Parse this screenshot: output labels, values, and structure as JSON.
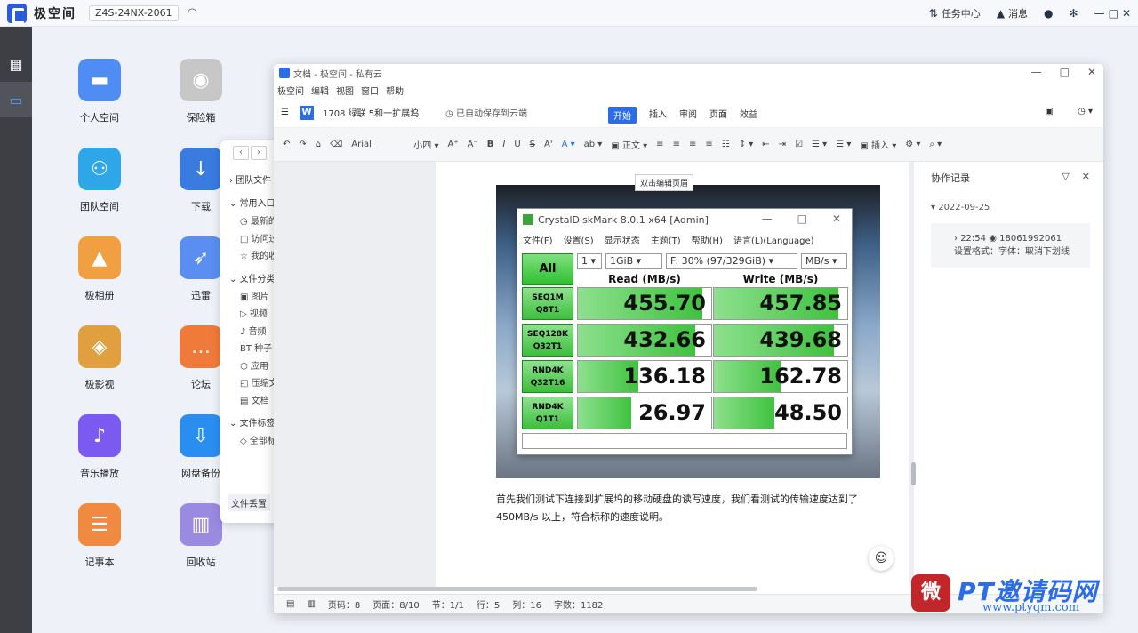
{
  "topbar": {
    "app_title": "极空间",
    "device": "Z4S-24NX-2061",
    "task_center": "任务中心",
    "messages": "消息"
  },
  "desktop": {
    "icons": [
      {
        "label": "个人空间",
        "color": "#4f8df5",
        "icon": "folder-icon"
      },
      {
        "label": "保险箱",
        "color": "#c7c7c7",
        "icon": "safe-icon"
      },
      {
        "label": "团队空间",
        "color": "#2fa6e8",
        "icon": "team-folder-icon"
      },
      {
        "label": "下载",
        "color": "#3a7be0",
        "icon": "download-globe-icon"
      },
      {
        "label": "极相册",
        "color": "#f0a040",
        "icon": "photo-album-icon"
      },
      {
        "label": "迅雷",
        "color": "#5a8ef0",
        "icon": "thunder-icon"
      },
      {
        "label": "极影视",
        "color": "#e0a040",
        "icon": "video-icon"
      },
      {
        "label": "论坛",
        "color": "#ef7a3a",
        "icon": "forum-icon"
      },
      {
        "label": "音乐播放",
        "color": "#7a5af0",
        "icon": "music-icon"
      },
      {
        "label": "网盘备份",
        "color": "#2a8ef0",
        "icon": "cloud-backup-icon"
      },
      {
        "label": "记事本",
        "color": "#f08a40",
        "icon": "notepad-icon"
      },
      {
        "label": "回收站",
        "color": "#9a8ae0",
        "icon": "trash-icon"
      }
    ]
  },
  "filemanager": {
    "team_files": "团队文件",
    "common": "常用入口",
    "recent": "最新的",
    "visit": "访问过",
    "mine": "我的收",
    "file_types": "文件分类",
    "images": "图片",
    "video": "视频",
    "audio": "音频",
    "seeds": "种子",
    "apps": "应用",
    "zip": "压缩文",
    "docs": "文档",
    "tags": "文件标签",
    "all_tags": "全部标",
    "footer": "文件丢置"
  },
  "doc": {
    "window_title": "文档 - 极空间 - 私有云",
    "menu": [
      "极空间",
      "编辑",
      "视图",
      "窗口",
      "帮助"
    ],
    "file_name": "1708 绿联 5和一扩展坞",
    "saved": "已自动保存到云端",
    "tabs": [
      "开始",
      "插入",
      "审阅",
      "页面",
      "效益"
    ],
    "font": "Arial",
    "size": "小四",
    "style": "正文",
    "insert": "插入",
    "tooltip": "双击编辑页眉",
    "paragraph": "首先我们测试下连接到扩展坞的移动硬盘的读写速度，我们看测试的传输速度达到了450MB/s 以上，符合标称的速度说明。",
    "status": {
      "page": "页码：8",
      "pages": "页面：8/10",
      "section": "节：1/1",
      "row": "行：5",
      "col": "列：16",
      "words": "字数：1182"
    },
    "collab": {
      "title": "协作记录",
      "date": "2022-09-25",
      "time": "22:54",
      "user": "18061992061",
      "action": "设置格式：字体：取消下划线"
    }
  },
  "cdm": {
    "title": "CrystalDiskMark 8.0.1 x64 [Admin]",
    "menu": [
      "文件(F)",
      "设置(S)",
      "显示状态",
      "主题(T)",
      "帮助(H)",
      "语言(L)(Language)"
    ],
    "all": "All",
    "count": "1",
    "size": "1GiB",
    "drive": "F: 30% (97/329GiB)",
    "unit": "MB/s",
    "read_hdr": "Read (MB/s)",
    "write_hdr": "Write (MB/s)",
    "rows": [
      {
        "l1": "SEQ1M",
        "l2": "Q8T1",
        "read": "455.70",
        "write": "457.85",
        "rfill": 0.93,
        "wfill": 0.93
      },
      {
        "l1": "SEQ128K",
        "l2": "Q32T1",
        "read": "432.66",
        "write": "439.68",
        "rfill": 0.88,
        "wfill": 0.9
      },
      {
        "l1": "RND4K",
        "l2": "Q32T16",
        "read": "136.18",
        "write": "162.78",
        "rfill": 0.45,
        "wfill": 0.5
      },
      {
        "l1": "RND4K",
        "l2": "Q1T1",
        "read": "26.97",
        "write": "48.50",
        "rfill": 0.4,
        "wfill": 0.45
      }
    ]
  },
  "watermark": {
    "brand": "PT邀请码网",
    "url": "www.ptyqm.com",
    "badge": "微"
  }
}
